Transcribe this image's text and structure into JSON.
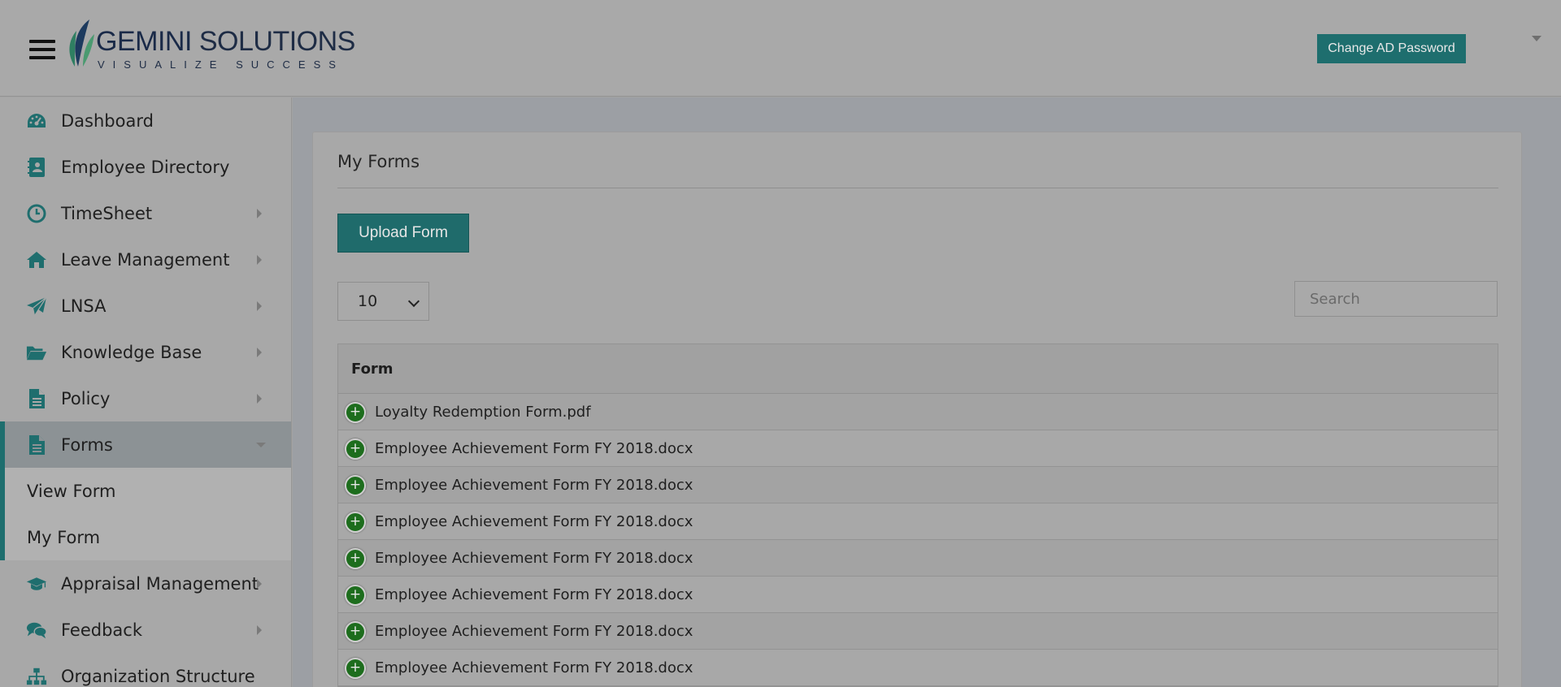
{
  "header": {
    "logo_brand_part1": "GEMINI",
    "logo_brand_part2": " SOLUTIONS",
    "logo_tagline": "VISUALIZE SUCCESS",
    "change_password_label": "Change AD Password"
  },
  "sidebar": {
    "items": [
      {
        "label": "Dashboard",
        "icon": "dashboard-icon"
      },
      {
        "label": "Employee Directory",
        "icon": "contact-book-icon"
      },
      {
        "label": "TimeSheet",
        "icon": "clock-icon"
      },
      {
        "label": "Leave Management",
        "icon": "home-icon"
      },
      {
        "label": "LNSA",
        "icon": "paper-plane-icon"
      },
      {
        "label": "Knowledge Base",
        "icon": "folder-open-icon"
      },
      {
        "label": "Policy",
        "icon": "document-icon"
      },
      {
        "label": "Forms",
        "icon": "document-icon"
      },
      {
        "label": "Appraisal Management",
        "icon": "graduation-cap-icon"
      },
      {
        "label": "Feedback",
        "icon": "comments-icon"
      },
      {
        "label": "Organization Structure",
        "icon": "sitemap-icon"
      }
    ],
    "forms_submenu": [
      {
        "label": "View Form"
      },
      {
        "label": "My Form"
      }
    ]
  },
  "main": {
    "card_title": "My Forms",
    "upload_label": "Upload Form",
    "page_size": "10",
    "search_placeholder": "Search",
    "table": {
      "column_header": "Form",
      "rows": [
        "Loyalty Redemption Form.pdf",
        "Employee Achievement Form FY 2018.docx",
        "Employee Achievement Form FY 2018.docx",
        "Employee Achievement Form FY 2018.docx",
        "Employee Achievement Form FY 2018.docx",
        "Employee Achievement Form FY 2018.docx",
        "Employee Achievement Form FY 2018.docx",
        "Employee Achievement Form FY 2018.docx"
      ]
    }
  },
  "colors": {
    "accent": "#1e6e6e",
    "row_action": "#1d6d1d"
  }
}
